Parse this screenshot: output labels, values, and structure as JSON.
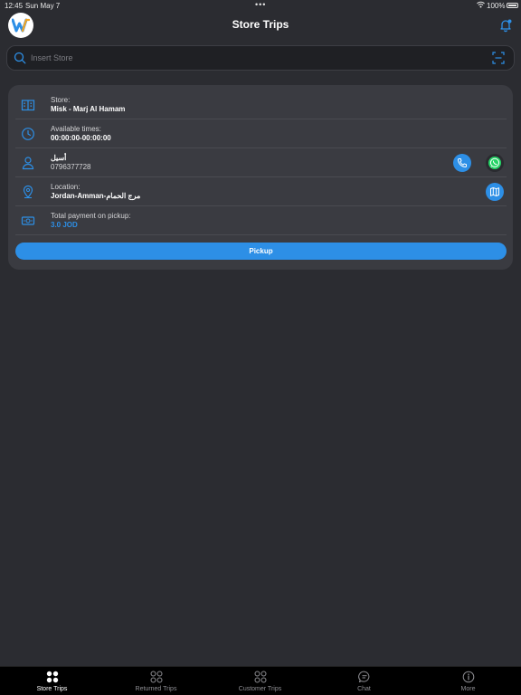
{
  "status_bar": {
    "time": "12:45",
    "date": "Sun May 7",
    "dots": "•••",
    "battery": "100%"
  },
  "header": {
    "title": "Store Trips"
  },
  "search": {
    "placeholder": "Insert Store",
    "value": ""
  },
  "trip": {
    "store_label": "Store:",
    "store_value": "Misk - Marj Al Hamam",
    "times_label": "Available times:",
    "times_value": "00:00:00-00:00:00",
    "contact_name": "أسيل",
    "contact_phone": "0796377728",
    "location_label": "Location:",
    "location_value": "Jordan-Amman-مرج الحمام",
    "payment_label": "Total payment on pickup:",
    "payment_value": "3.0 JOD",
    "pickup_label": "Pickup"
  },
  "tabs": [
    {
      "label": "Store Trips",
      "icon": "grid-filled-icon",
      "active": true
    },
    {
      "label": "Returned Trips",
      "icon": "grid-outline-icon",
      "active": false
    },
    {
      "label": "Customer Trips",
      "icon": "grid-outline-icon",
      "active": false
    },
    {
      "label": "Chat",
      "icon": "chat-icon",
      "active": false
    },
    {
      "label": "More",
      "icon": "more-icon",
      "active": false
    }
  ],
  "colors": {
    "background": "#2b2c31",
    "card": "#3a3b41",
    "accent": "#2d8fe6",
    "whatsapp": "#25d366"
  }
}
